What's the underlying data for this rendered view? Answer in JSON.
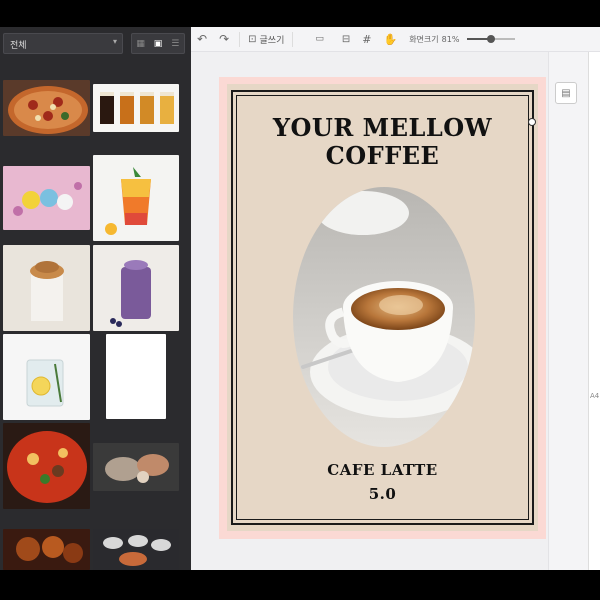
{
  "filter": {
    "selected": "전체"
  },
  "toolbar": {
    "write_label": "글쓰기",
    "zoom_label": "화면크기",
    "zoom_value": "81%"
  },
  "poster": {
    "title_line1": "YOUR MELLOW",
    "title_line2": "COFFEE",
    "item_name": "CAFE LATTE",
    "price": "5.0"
  },
  "right_panel": {
    "page_size": "A4"
  },
  "colors": {
    "poster_bg": "#e6d7c6",
    "page_border": "#fbd9d4",
    "panel_dark": "#2b2b2e"
  },
  "icons": [
    "undo-icon",
    "redo-icon",
    "text-box-icon",
    "spellcheck-icon",
    "grid-icon",
    "hand-icon",
    "document-icon"
  ]
}
